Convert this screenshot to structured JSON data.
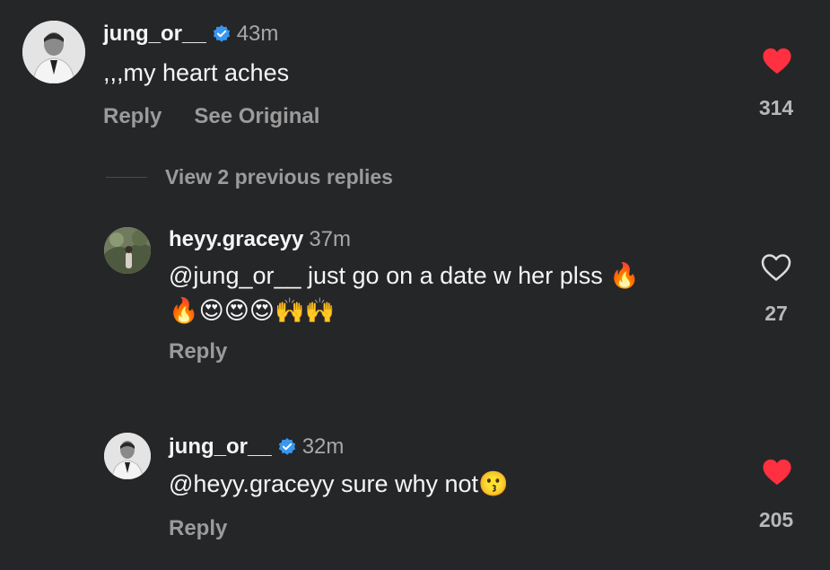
{
  "comments": [
    {
      "username": "jung_or__",
      "verified": true,
      "time": "43m",
      "text": ",,,my heart aches",
      "actions": [
        "Reply",
        "See Original"
      ],
      "likes": "314",
      "liked": true
    },
    {
      "username": "heyy.graceyy",
      "verified": false,
      "time": "37m",
      "text_line1": "@jung_or__ just go on a date w her plss 🔥",
      "text_line2": "🔥😍😍😍🙌🙌",
      "actions": [
        "Reply"
      ],
      "likes": "27",
      "liked": false
    },
    {
      "username": "jung_or__",
      "verified": true,
      "time": "32m",
      "text": "@heyy.graceyy sure why not😗",
      "actions": [
        "Reply"
      ],
      "likes": "205",
      "liked": true
    }
  ],
  "view_replies": "View 2 previous replies",
  "colors": {
    "background": "#252628",
    "liked_heart": "#ff3040",
    "verified": "#3897f0"
  },
  "icons": [
    "verified-badge-icon",
    "heart-filled-icon",
    "heart-outline-icon"
  ]
}
